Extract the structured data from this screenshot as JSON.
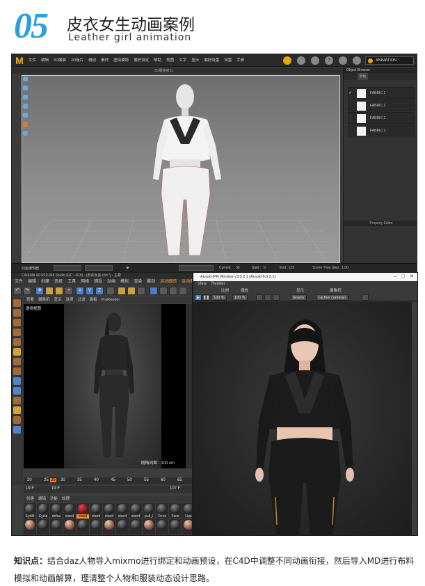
{
  "header": {
    "number": "05",
    "title": "皮衣女生动画案例",
    "subtitle": "Leather girl animation"
  },
  "md_window": {
    "logo": "M",
    "menu": [
      "文件",
      "编辑",
      "3D服装",
      "2D板片",
      "缝纫",
      "素材",
      "虚拟模特",
      "偏好设定",
      "帮助",
      "视图",
      "文字",
      "显示",
      "偏好设置",
      "设置",
      "手册"
    ],
    "mode_button": "ANIMATION",
    "viewport_title": "3D服装窗口",
    "object_browser": {
      "title": "Object Browser",
      "tabs": [
        "织物"
      ],
      "fabrics": [
        "FABRIC 1",
        "FABRIC 1",
        "FABRIC 2",
        "FABRIC 3"
      ],
      "selected_index": 0
    },
    "property_editor": "Property Editor",
    "timeline": {
      "editor_label": "动画编辑器",
      "current_label": "Current :",
      "current_value": "30",
      "start_label": "Start :",
      "start_value": "0",
      "end_label": "End :",
      "end_value": "119",
      "timestep_label": "Scene Time Step",
      "timestep_value": "1.00"
    }
  },
  "c4d_window": {
    "title": "CINEMA 4D R19.068 Studio (RC - R19) - [皮衣女孩.c4d *] - 主要",
    "menu": [
      "文件",
      "编辑",
      "创建",
      "选择",
      "工具",
      "网格",
      "捕捉",
      "动画",
      "模拟",
      "渲染",
      "雕刻",
      "运动跟踪",
      "运动图形"
    ],
    "tool_letters": [
      "X",
      "Y",
      "Z"
    ],
    "view_menu": [
      "查看",
      "摄像机",
      "显示",
      "选项",
      "过滤",
      "面板",
      "ProRender"
    ],
    "view_label": "透视视图",
    "grid_label": "网格间距 : 100 cm",
    "ruler": [
      "20",
      "25",
      "26",
      "30",
      "35",
      "40",
      "45",
      "50",
      "55",
      "60",
      "65"
    ],
    "current_frame": "26",
    "frame_start": "19 F",
    "frame_field": "19 F",
    "frame_end": "107 F",
    "material_menu": [
      "创建",
      "编辑",
      "功能",
      "纹理"
    ],
    "materials": [
      "EyeM",
      "Eyela",
      "defau",
      "stand",
      "stand",
      "stand",
      "stand",
      "stand",
      "stand",
      "pull_l",
      "Torso",
      "Face",
      "Lips"
    ],
    "selected_material": 4
  },
  "arnold_window": {
    "title": "Arnold IPR Window v3.0.2.1 (Arnold 6.0.2.1)",
    "menu": [
      "View",
      "Render"
    ],
    "labels": [
      "比例",
      "缩放",
      "显示",
      "摄像机"
    ],
    "zoom1": "100 %",
    "zoom2": "100 %",
    "display": "beauty",
    "camera": "<active camera>"
  },
  "footer": {
    "label": "知识点：",
    "text": "结合daz人物导入mixmo进行绑定和动画预设，在C4D中调整不同动画衔接，然后导入MD进行布料模拟和动画解算，理清整个人物和服装动态设计思路。"
  }
}
